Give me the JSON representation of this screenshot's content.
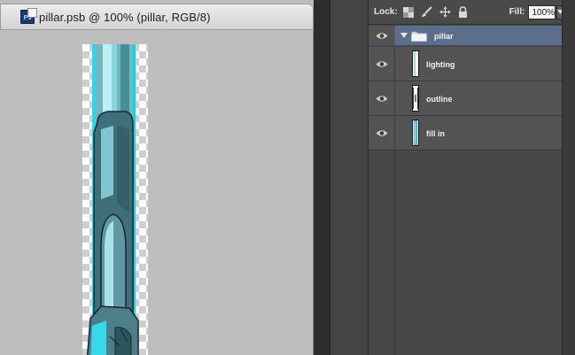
{
  "document": {
    "title": "pillar.psb @ 100% (pillar, RGB/8)",
    "file_icon": "ps-file-icon",
    "file_icon_text": "Ps"
  },
  "layers_toolbar": {
    "lock_label": "Lock:",
    "lock_icons": [
      "lock-transparent-icon",
      "lock-image-icon",
      "lock-position-icon",
      "lock-all-icon"
    ],
    "fill_label": "Fill:",
    "fill_value": "100%"
  },
  "layers": {
    "group": {
      "name": "pillar",
      "visible": true,
      "expanded": true
    },
    "items": [
      {
        "name": "lighting",
        "visible": true
      },
      {
        "name": "outline",
        "visible": true
      },
      {
        "name": "fill in",
        "visible": true
      }
    ]
  },
  "colors": {
    "canvas_bg": "#bebebe",
    "panel_bg": "#474747",
    "selected_layer": "#5d6e8b",
    "pillar_cyan": "#2fd7e6"
  }
}
